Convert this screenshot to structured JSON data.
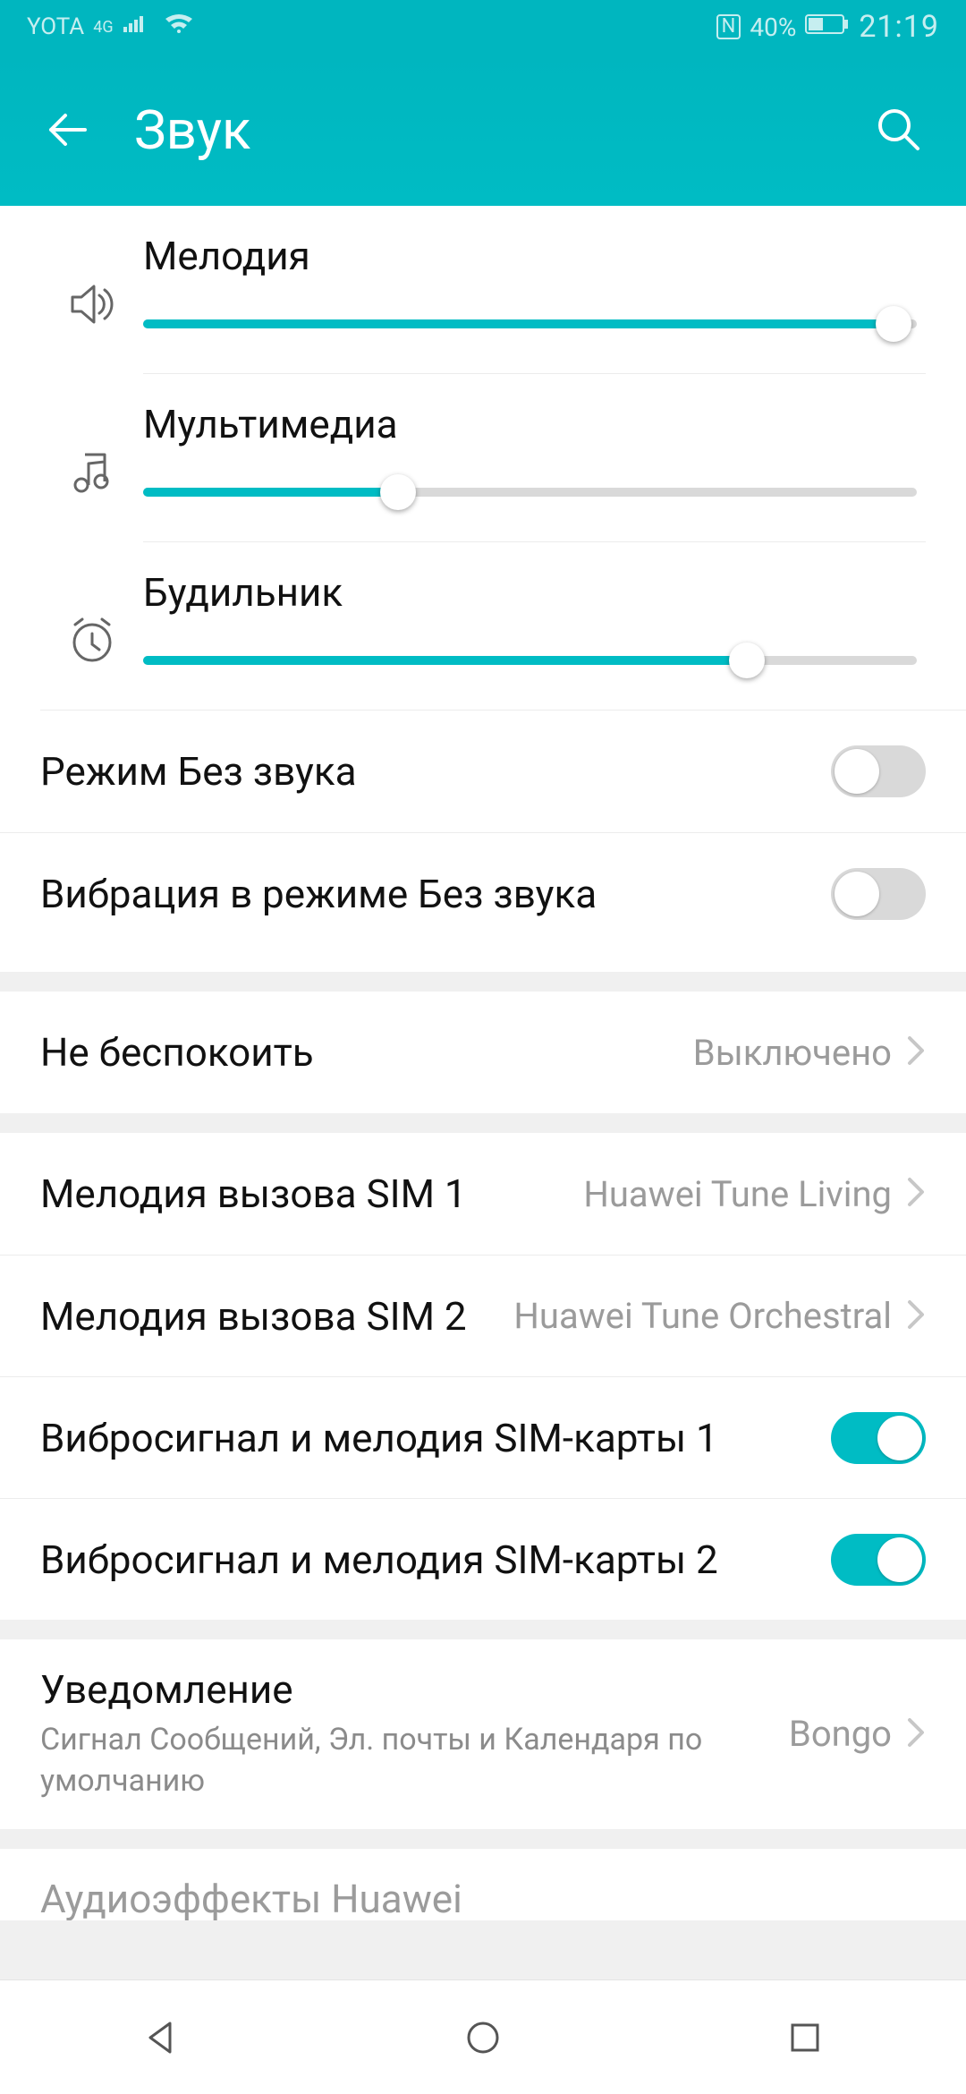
{
  "status": {
    "carrier": "YOTA",
    "network": "4G",
    "nfc": "N",
    "battery": "40%",
    "time": "21:19"
  },
  "appbar": {
    "title": "Звук"
  },
  "sliders": {
    "ringtone": {
      "label": "Мелодия",
      "value": 97
    },
    "media": {
      "label": "Мультимедиа",
      "value": 33
    },
    "alarm": {
      "label": "Будильник",
      "value": 78
    }
  },
  "toggles": {
    "silent": {
      "label": "Режим Без звука",
      "on": false
    },
    "vibrate_silent": {
      "label": "Вибрация в режиме Без звука",
      "on": false
    },
    "vibrate_sim1": {
      "label": "Вибросигнал и мелодия SIM-карты 1",
      "on": true
    },
    "vibrate_sim2": {
      "label": "Вибросигнал и мелодия SIM-карты 2",
      "on": true
    }
  },
  "links": {
    "dnd": {
      "label": "Не беспокоить",
      "value": "Выключено"
    },
    "ringtone_sim1": {
      "label": "Мелодия вызова SIM 1",
      "value": "Huawei Tune Living"
    },
    "ringtone_sim2": {
      "label": "Мелодия вызова SIM 2",
      "value": "Huawei Tune Orchestral"
    },
    "notification": {
      "label": "Уведомление",
      "sub": "Сигнал Сообщений, Эл. почты и Календаря по умолчанию",
      "value": "Bongo"
    },
    "audio_effects": {
      "label": "Аудиоэффекты Huawei"
    }
  }
}
